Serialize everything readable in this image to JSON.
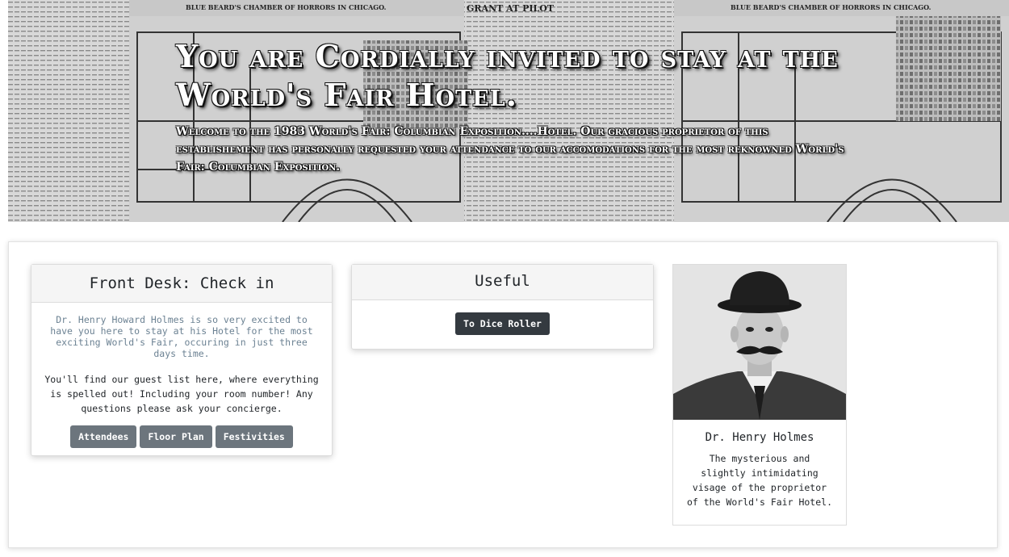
{
  "hero": {
    "title": "You are Cordially invited to stay at the World's Fair Hotel.",
    "subtitle": "Welcome to the 1983 World's Fair: Columbian Exposition....Hotel. Our gracious proprietor of this establishement has personally requested your attendance to our accomodations for the most reknowned World's Fair: Columbian Exposition.",
    "newspaper_headline_left": "BLUE BEARD'S CHAMBER OF HORRORS IN CHICAGO.",
    "newspaper_headline_center": "GRANT AT PILOT",
    "newspaper_headline_right": "BLUE BEARD'S CHAMBER OF HORRORS IN CHICAGO."
  },
  "front_desk": {
    "title": "Front Desk: Check in",
    "intro": "Dr. Henry Howard Holmes is so very excited to have you here to stay at his Hotel for the most exciting World's Fair, occuring in just three days time.",
    "info": "You'll find our guest list here, where everything is spelled out! Including your room number! Any questions please ask your concierge.",
    "buttons": [
      "Attendees",
      "Floor Plan",
      "Festivities"
    ]
  },
  "useful": {
    "title": "Useful",
    "button": "To Dice Roller"
  },
  "portrait": {
    "name": "Dr. Henry Holmes",
    "caption": "The mysterious and slightly intimidating visage of the proprietor of the World's Fair Hotel."
  },
  "colors": {
    "button_gray": "#6c757d",
    "button_dark": "#343a40",
    "intro_text": "#6c8293"
  }
}
